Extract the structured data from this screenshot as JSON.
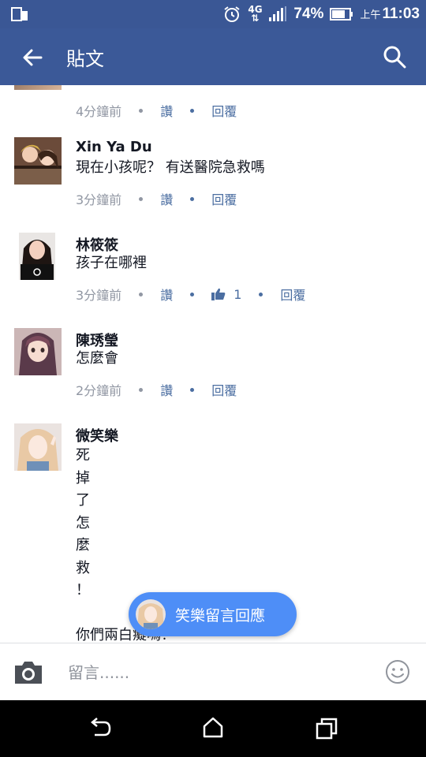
{
  "status_bar": {
    "network": "4G",
    "battery_percent": "74%",
    "time_prefix": "上午",
    "time": "11:03"
  },
  "header": {
    "title": "貼文"
  },
  "actions": {
    "like": "讚",
    "reply": "回覆"
  },
  "comments": [
    {
      "name": "",
      "text": "",
      "time": "4分鐘前",
      "likes": ""
    },
    {
      "name": "Xin Ya Du",
      "text": "現在小孩呢？ 有送醫院急救嗎",
      "time": "3分鐘前",
      "likes": ""
    },
    {
      "name": "林筱筱",
      "text": "孩子在哪裡",
      "time": "3分鐘前",
      "likes": "1"
    },
    {
      "name": "陳琇瑩",
      "text": "怎麼會",
      "time": "2分鐘前",
      "likes": ""
    },
    {
      "name": "微笑樂",
      "text_lines": [
        "死",
        "掉",
        "了",
        "怎",
        "麼",
        "救",
        "！",
        "",
        "你們兩白癡嗎！"
      ],
      "time": "",
      "likes": ""
    }
  ],
  "floating_button": {
    "label": "笑樂留言回應"
  },
  "input_bar": {
    "placeholder": "留言......"
  },
  "colors": {
    "header_bg": "#3b5998",
    "statusbar_bg": "#3a5795",
    "action_link": "#4b6ea1",
    "pill_bg": "#4e8ef7"
  }
}
